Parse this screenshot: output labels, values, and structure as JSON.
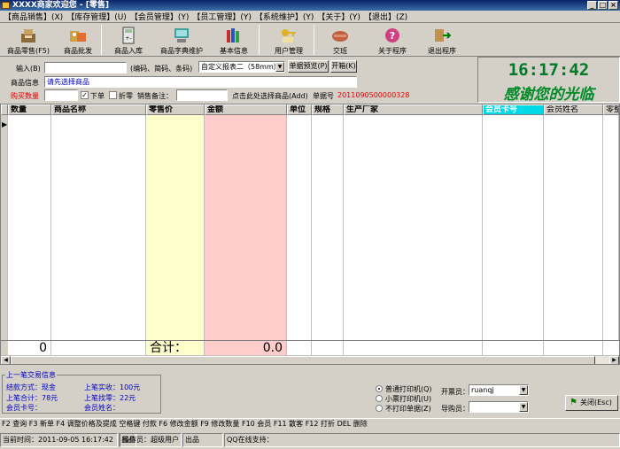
{
  "window": {
    "title": "XXXX商家欢迎您 - [零售]"
  },
  "menu": [
    "【商品销售】(X)",
    "【库存管理】(U)",
    "【会员管理】(Y)",
    "【员工管理】(Y)",
    "【系统维护】(Y)",
    "【关于】(Y)",
    "【退出】(Z)"
  ],
  "toolbar": [
    "商品零售(F5)",
    "商品批发",
    "商品入库",
    "商品字典维护",
    "基本信息",
    "用户管理",
    "交班",
    "关于程序",
    "退出程序"
  ],
  "form": {
    "input_label": "输入(B)",
    "input_value": "",
    "input_hint": "(编码、简码、条码)",
    "print_template": "自定义报表二（58mm）",
    "preview_button": "单据预览(P)",
    "open_drawer_button": "开箱(K)",
    "goods_info_label": "商品信息",
    "goods_info_value": "请先选择商品",
    "qty_label": "购买数量",
    "qty_value": "",
    "place_order": "下单",
    "discount": "折零",
    "sales_note_label": "销售备注：",
    "sales_note_value": "",
    "select_goods_link": "点击此处选择商品(Add)",
    "bill_no_label": "单据号",
    "bill_no_value": "2011090500000328"
  },
  "clock": {
    "time": "16:17:42",
    "thanks": "感谢您的光临"
  },
  "table": {
    "columns": [
      "数量",
      "商品名称",
      "零售价",
      "金额",
      "单位",
      "规格",
      "生产厂家",
      "会员卡号",
      "会员姓名",
      "零整"
    ],
    "rows": [],
    "totals": {
      "quantity": "0",
      "label": "合计：",
      "amount": "0.0"
    }
  },
  "last_transaction": {
    "title": "上一笔交易信息",
    "payment_method": "结款方式：现金",
    "received": "上笔实收：100元",
    "total": "上笔合计：78元",
    "change": "上笔找零：22元",
    "member_card": "会员卡号：",
    "member_name": "会员姓名："
  },
  "print_options": {
    "options": [
      "普通打印机(Q)",
      "小票打印机(U)",
      "不打印单据(Z)"
    ],
    "selected_index": 0
  },
  "staff": {
    "cashier_label": "开票员：",
    "cashier_value": "ruanqj",
    "guide_label": "导购员：",
    "guide_value": ""
  },
  "close_button": "关闭(Esc)",
  "hotkeys": "F2 查询 F3 新单 F4 调整价格及提成  空格键 付款  F6 修改金额   F9 修改数量 F10 会员 F11 散客 F12 打折 DEL 删除",
  "status": {
    "time": "当前时间：2011-09-05 16:17:42",
    "dept": "出品",
    "operator": "操作员：超级用户",
    "extra": "出品",
    "qq": "QQ在线支持："
  }
}
